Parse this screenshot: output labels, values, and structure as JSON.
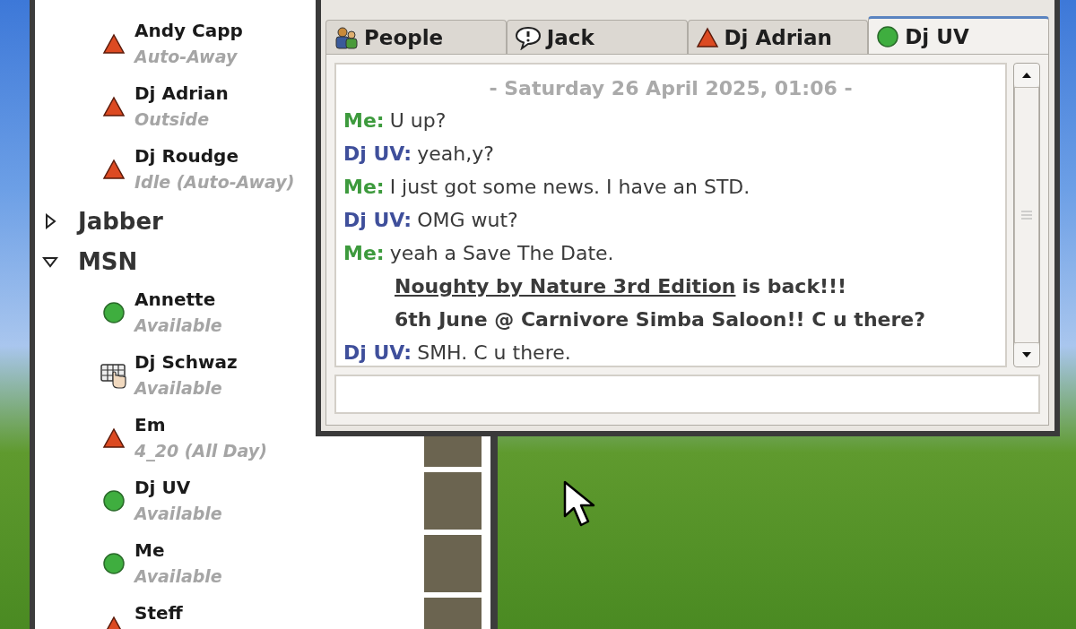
{
  "buddy_list": {
    "top_buddies": [
      {
        "name": "Andy Capp",
        "status": "Auto-Away",
        "kind": "away"
      },
      {
        "name": "Dj Adrian",
        "status": "Outside",
        "kind": "away"
      },
      {
        "name": "Dj Roudge",
        "status": "Idle (Auto-Away)",
        "kind": "away"
      }
    ],
    "groups": [
      {
        "name": "Jabber",
        "expanded": false
      },
      {
        "name": "MSN",
        "expanded": true,
        "buddies": [
          {
            "name": "Annette",
            "status": "Available",
            "kind": "available"
          },
          {
            "name": "Dj Schwaz",
            "status": "Available",
            "kind": "mobile"
          },
          {
            "name": "Em",
            "status": "4_20 (All Day)",
            "kind": "away",
            "avatar": true
          },
          {
            "name": "Dj UV",
            "status": "Available",
            "kind": "available",
            "avatar": true
          },
          {
            "name": "Me",
            "status": "Available",
            "kind": "available",
            "avatar": true
          },
          {
            "name": "Steff",
            "kind": "away",
            "avatar": true
          }
        ]
      }
    ]
  },
  "chat": {
    "tabs": [
      {
        "label": "People",
        "kind": "people",
        "selected": false
      },
      {
        "label": "Jack",
        "kind": "alert",
        "selected": false
      },
      {
        "label": "Dj Adrian",
        "kind": "away",
        "selected": false
      },
      {
        "label": "Dj UV",
        "kind": "available",
        "selected": true
      }
    ],
    "date": "- Saturday 26 April 2025, 01:06 -",
    "messages": [
      {
        "sender": "Me:",
        "color": "#3d9a3d",
        "text": "U up?"
      },
      {
        "sender": "Dj UV:",
        "color": "#3f4f9b",
        "text": "yeah,y?"
      },
      {
        "sender": "Me:",
        "color": "#3d9a3d",
        "text": "I just got some news. I have an STD."
      },
      {
        "sender": "Dj UV:",
        "color": "#3f4f9b",
        "text": "OMG wut?"
      },
      {
        "sender": "Me:",
        "color": "#3d9a3d",
        "text": "yeah a Save The Date.",
        "continuation": [
          [
            {
              "kind": "link",
              "text": "Noughty by Nature 3rd Edition"
            },
            {
              "kind": "plain",
              "text": "is back!!!"
            }
          ],
          [
            {
              "kind": "plain",
              "text": "6th June @ Carnivore Simba Saloon!! C u there?"
            }
          ]
        ]
      },
      {
        "sender": "Dj UV:",
        "color": "#3f4f9b",
        "text": "SMH. C u there."
      }
    ]
  }
}
